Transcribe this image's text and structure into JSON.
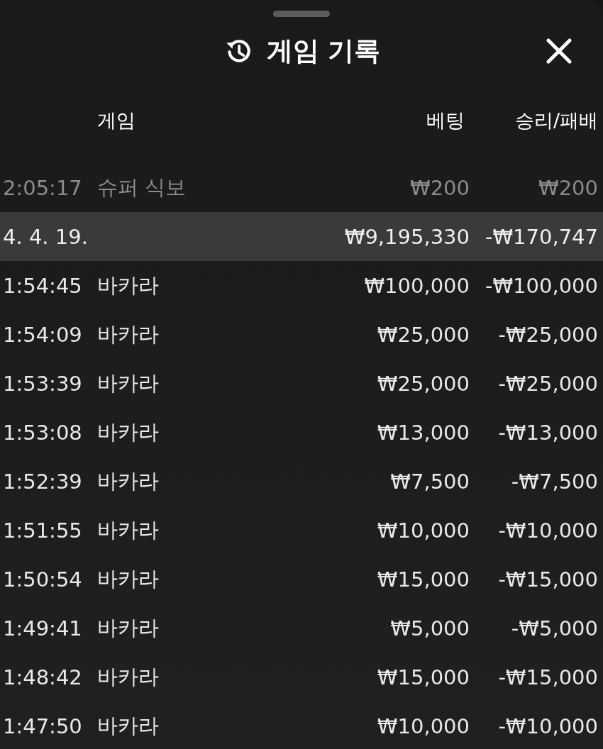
{
  "title": "게임 기록",
  "header": {
    "game": "게임",
    "bet": "베팅",
    "result": "승리/패배"
  },
  "rows": [
    {
      "kind": "game",
      "faded": true,
      "time": "2:05:17",
      "game": "슈퍼 식보",
      "bet": "₩200",
      "result": "₩200"
    },
    {
      "kind": "date",
      "date": "4. 4. 19.",
      "bet": "₩9,195,330",
      "result": "-₩170,747"
    },
    {
      "kind": "game",
      "faded": false,
      "time": "1:54:45",
      "game": "바카라",
      "bet": "₩100,000",
      "result": "-₩100,000"
    },
    {
      "kind": "game",
      "faded": false,
      "time": "1:54:09",
      "game": "바카라",
      "bet": "₩25,000",
      "result": "-₩25,000"
    },
    {
      "kind": "game",
      "faded": false,
      "time": "1:53:39",
      "game": "바카라",
      "bet": "₩25,000",
      "result": "-₩25,000"
    },
    {
      "kind": "game",
      "faded": false,
      "time": "1:53:08",
      "game": "바카라",
      "bet": "₩13,000",
      "result": "-₩13,000"
    },
    {
      "kind": "game",
      "faded": false,
      "time": "1:52:39",
      "game": "바카라",
      "bet": "₩7,500",
      "result": "-₩7,500"
    },
    {
      "kind": "game",
      "faded": false,
      "time": "1:51:55",
      "game": "바카라",
      "bet": "₩10,000",
      "result": "-₩10,000"
    },
    {
      "kind": "game",
      "faded": false,
      "time": "1:50:54",
      "game": "바카라",
      "bet": "₩15,000",
      "result": "-₩15,000"
    },
    {
      "kind": "game",
      "faded": false,
      "time": "1:49:41",
      "game": "바카라",
      "bet": "₩5,000",
      "result": "-₩5,000"
    },
    {
      "kind": "game",
      "faded": false,
      "time": "1:48:42",
      "game": "바카라",
      "bet": "₩15,000",
      "result": "-₩15,000"
    },
    {
      "kind": "game",
      "faded": false,
      "time": "1:47:50",
      "game": "바카라",
      "bet": "₩10,000",
      "result": "-₩10,000"
    }
  ]
}
